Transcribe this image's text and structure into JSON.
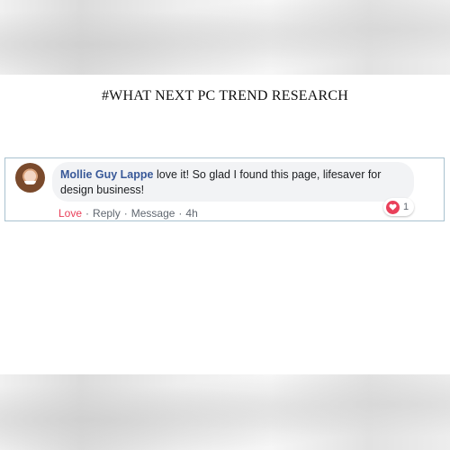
{
  "header": {
    "title": "#WHAT NEXT PC TREND RESEARCH"
  },
  "comment": {
    "author": "Mollie Guy Lappe",
    "text": " love it! So glad I found this page, lifesaver for design business!",
    "actions": {
      "love": "Love",
      "reply": "Reply",
      "message": "Message",
      "separator": "·",
      "time": "4h"
    },
    "reaction": {
      "icon": "heart-icon",
      "count": "1",
      "color": "#e9405a"
    }
  },
  "colors": {
    "author_link": "#385898",
    "love_active": "#e9405a",
    "bubble_bg": "#f2f3f5",
    "card_border": "#a9c2cf"
  }
}
